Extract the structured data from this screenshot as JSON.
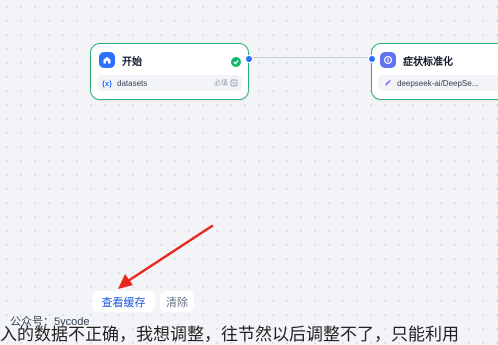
{
  "nodes": {
    "start": {
      "title": "开始",
      "var_symbol": "{x}",
      "var_name": "datasets",
      "required_label": "必填"
    },
    "llm": {
      "title": "症状标准化",
      "model": "deepseek-ai/DeepSe..."
    }
  },
  "buttons": {
    "view_cache": "查看缓存",
    "clear": "清除"
  },
  "watermark": "公众号：5ycode",
  "bottom_text": "入的数据不正确，我想调整，往节然以后调整不了，只能利用",
  "colors": {
    "node_border": "#2fae7a",
    "start_icon": "#2970ff",
    "llm_icon": "#6172f3",
    "success": "#12b76a",
    "arrow": "#e8281e",
    "link_blue": "#1a56db"
  },
  "icons": {
    "start": "home-icon",
    "llm": "llm-icon",
    "status": "check-circle-icon",
    "model": "model-icon"
  }
}
